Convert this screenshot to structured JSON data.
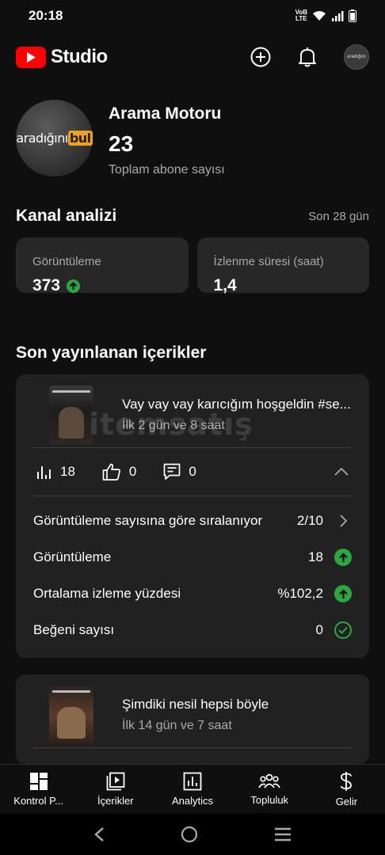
{
  "status_bar": {
    "time": "20:18",
    "network_top": "VoB",
    "network_bottom": "LTE"
  },
  "app": {
    "logo_text": "Studio"
  },
  "channel": {
    "name": "Arama Motoru",
    "subscribers": "23",
    "subscribers_label": "Toplam abone sayısı",
    "avatar_text_main": "aradığını",
    "avatar_text_box": "bul"
  },
  "analytics": {
    "title": "Kanal analizi",
    "period": "Son 28 gün",
    "cards": [
      {
        "label": "Görüntüleme",
        "value": "373",
        "trend": "up"
      },
      {
        "label": "İzlenme süresi (saat)",
        "value": "1,4"
      }
    ]
  },
  "recent": {
    "title": "Son yayınlanan içerikler",
    "items": [
      {
        "title": "Vay vay vay karıcığım hoşgeldin #se...",
        "time": "İlk 2 gün ve 8 saat",
        "views": "18",
        "likes": "0",
        "comments": "0",
        "expanded": true,
        "stats": [
          {
            "label": "Görüntüleme sayısına göre sıralanıyor",
            "value": "2/10",
            "trail": "chevron-right"
          },
          {
            "label": "Görüntüleme",
            "value": "18",
            "trail": "up"
          },
          {
            "label": "Ortalama izleme yüzdesi",
            "value": "%102,2",
            "trail": "up"
          },
          {
            "label": "Beğeni sayısı",
            "value": "0",
            "trail": "check"
          }
        ]
      },
      {
        "title": "Şimdiki nesil hepsi böyle",
        "time": "İlk 14 gün ve 7 saat"
      }
    ]
  },
  "watermark": "itemsatış",
  "bottom_nav": [
    {
      "label": "Kontrol P...",
      "icon": "dashboard-icon"
    },
    {
      "label": "İçerikler",
      "icon": "content-icon"
    },
    {
      "label": "Analytics",
      "icon": "analytics-icon"
    },
    {
      "label": "Topluluk",
      "icon": "community-icon"
    },
    {
      "label": "Gelir",
      "icon": "dollar-icon"
    }
  ],
  "colors": {
    "background": "#0f0f0f",
    "card": "#272727",
    "brand_red": "#ff0000",
    "positive": "#2ba640"
  }
}
